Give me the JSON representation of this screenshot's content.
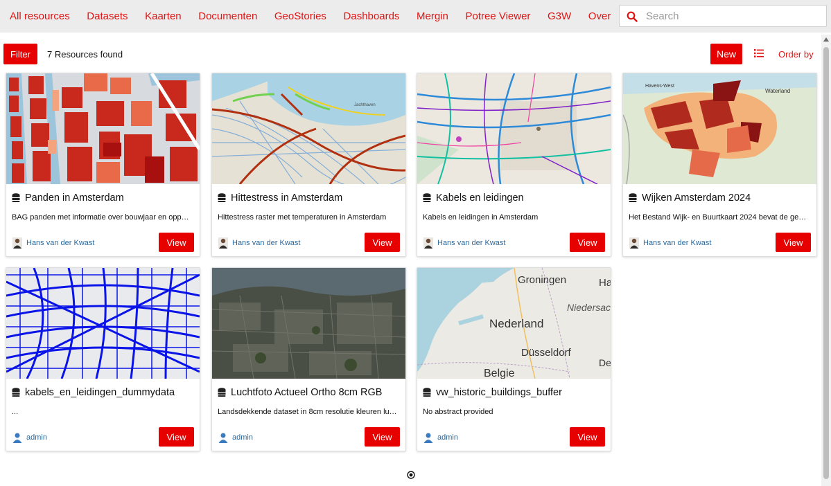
{
  "nav": {
    "links": [
      "All resources",
      "Datasets",
      "Kaarten",
      "Documenten",
      "GeoStories",
      "Dashboards",
      "Mergin",
      "Potree Viewer",
      "G3W",
      "Over"
    ],
    "link_color": "#e01414"
  },
  "search": {
    "placeholder": "Search",
    "value": "",
    "icon": "search-icon"
  },
  "toolbar": {
    "filter_label": "Filter",
    "results_count": "7 Resources found",
    "new_label": "New",
    "view_toggle_icon": "list-icon",
    "order_by_label": "Order by"
  },
  "accent_color": "#e60000",
  "resources": [
    {
      "title": "Panden in Amsterdam",
      "abstract": "BAG panden met informatie over bouwjaar en opp…",
      "owner": "Hans van der Kwast",
      "owner_icon": "user-photo-avatar",
      "type_icon": "database-icon",
      "view_label": "View"
    },
    {
      "title": "Hittestress in Amsterdam",
      "abstract": "Hittestress raster met temperaturen in Amsterdam",
      "owner": "Hans van der Kwast",
      "owner_icon": "user-photo-avatar",
      "type_icon": "database-icon",
      "view_label": "View"
    },
    {
      "title": "Kabels en leidingen",
      "abstract": "Kabels en leidingen in Amsterdam",
      "owner": "Hans van der Kwast",
      "owner_icon": "user-photo-avatar",
      "type_icon": "database-icon",
      "view_label": "View"
    },
    {
      "title": "Wijken Amsterdam 2024",
      "abstract": "Het Bestand Wijk- en Buurtkaart 2024 bevat de ge…",
      "owner": "Hans van der Kwast",
      "owner_icon": "user-photo-avatar",
      "type_icon": "database-icon",
      "view_label": "View"
    },
    {
      "title": "kabels_en_leidingen_dummydata",
      "abstract": "...",
      "owner": "admin",
      "owner_icon": "default-user-avatar",
      "type_icon": "database-icon",
      "view_label": "View"
    },
    {
      "title": "Luchtfoto Actueel Ortho 8cm RGB",
      "abstract": "Landsdekkende dataset in 8cm resolutie kleuren lu…",
      "owner": "admin",
      "owner_icon": "default-user-avatar",
      "type_icon": "database-icon",
      "view_label": "View"
    },
    {
      "title": "vw_historic_buildings_buffer",
      "abstract": "No abstract provided",
      "owner": "admin",
      "owner_icon": "default-user-avatar",
      "type_icon": "database-icon",
      "view_label": "View"
    }
  ],
  "thumbnail_labels": {
    "map2": [
      "Jachthaven"
    ],
    "map4": [
      "Havens-West",
      "Waterland"
    ],
    "map7": [
      "Groningen",
      "Ha",
      "Niedersac",
      "Nederland",
      "Düsseldorf",
      "Belgie",
      "De"
    ]
  }
}
